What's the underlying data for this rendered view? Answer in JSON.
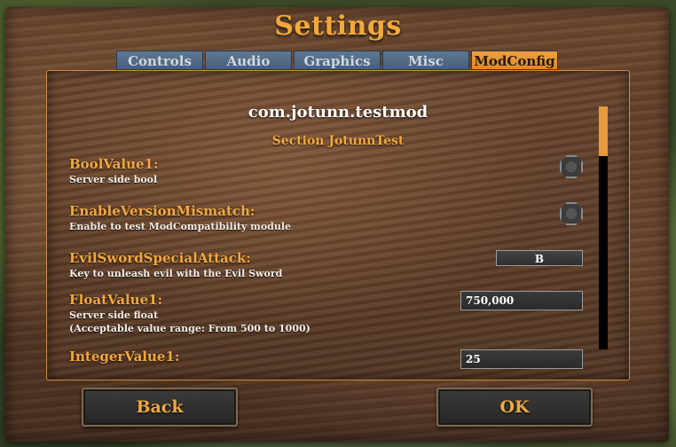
{
  "window": {
    "title": "Settings"
  },
  "tabs": [
    {
      "label": "Controls"
    },
    {
      "label": "Audio"
    },
    {
      "label": "Graphics"
    },
    {
      "label": "Misc"
    },
    {
      "label": "ModConfig"
    }
  ],
  "active_tab": "ModConfig",
  "mod": {
    "name": "com.jotunn.testmod",
    "section": "Section JotunnTest"
  },
  "entries": [
    {
      "name": "BoolValue1:",
      "description": "Server side bool",
      "control": "toggle",
      "value": false
    },
    {
      "name": "EnableVersionMismatch:",
      "description": "Enable to test ModCompatibility module",
      "control": "toggle",
      "value": false
    },
    {
      "name": "EvilSwordSpecialAttack:",
      "description": "Key to unleash evil with the Evil Sword",
      "control": "keybind",
      "value": "B"
    },
    {
      "name": "FloatValue1:",
      "description": "Server side float",
      "description2": "(Acceptable value range: From 500 to 1000)",
      "control": "number",
      "value": "750,000"
    },
    {
      "name": "IntegerValue1:",
      "control": "number",
      "value": "25"
    }
  ],
  "scrollbar": {
    "position_fraction": 0.0
  },
  "buttons": {
    "back": "Back",
    "ok": "OK"
  },
  "colors": {
    "accent": "#f2a83b",
    "tab": "#5f7893",
    "tab_active": "#f0a040"
  }
}
